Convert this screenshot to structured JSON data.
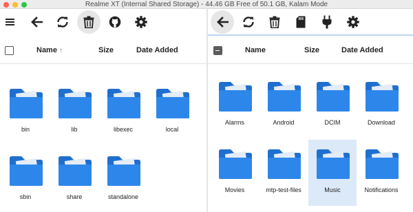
{
  "window": {
    "title": "Realme XT (Internal Shared Storage) - 44.46 GB Free of 50.1 GB, Kalam Mode"
  },
  "left_pane": {
    "toolbar": [
      "menu-icon",
      "back-icon",
      "refresh-icon",
      "delete-icon",
      "github-icon",
      "settings-icon"
    ],
    "columns": {
      "name": "Name",
      "size": "Size",
      "date": "Date Added",
      "sort_indicator": "↑"
    },
    "items": [
      {
        "label": "bin"
      },
      {
        "label": "lib"
      },
      {
        "label": "libexec"
      },
      {
        "label": "local"
      },
      {
        "label": "sbin"
      },
      {
        "label": "share"
      },
      {
        "label": "standalone"
      }
    ]
  },
  "right_pane": {
    "toolbar": [
      "back-icon",
      "refresh-icon",
      "delete-icon",
      "sd-card-icon",
      "plug-icon",
      "settings-icon"
    ],
    "columns": {
      "name": "Name",
      "size": "Size",
      "date": "Date Added"
    },
    "items": [
      {
        "label": "Alarms"
      },
      {
        "label": "Android"
      },
      {
        "label": "DCIM"
      },
      {
        "label": "Download"
      },
      {
        "label": "Movies"
      },
      {
        "label": "mtp-test-files"
      },
      {
        "label": "Music",
        "selected": true
      },
      {
        "label": "Notifications"
      }
    ]
  },
  "colors": {
    "folder_front": "#2d87ea",
    "folder_back": "#1f6fcf",
    "folder_paper": "#e3ecf7",
    "selection": "#dce9f9"
  }
}
